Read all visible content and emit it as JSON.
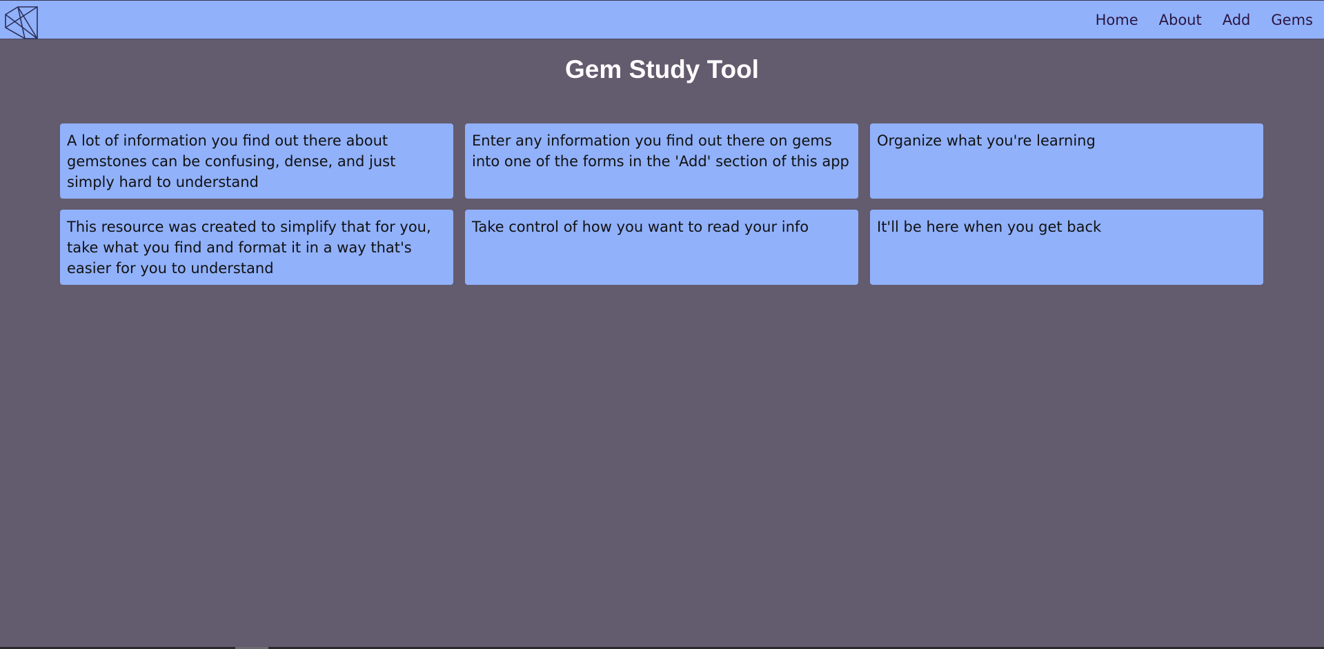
{
  "app": {
    "logo_icon": "gem-icon"
  },
  "nav": {
    "links": [
      {
        "label": "Home"
      },
      {
        "label": "About"
      },
      {
        "label": "Add"
      },
      {
        "label": "Gems"
      }
    ]
  },
  "main": {
    "title": "Gem Study Tool",
    "cards": [
      {
        "text": "A lot of information you find out there about gemstones can be confusing, dense, and just simply hard to understand"
      },
      {
        "text": "Enter any information you find out there on gems into one of the forms in the 'Add' section of this app"
      },
      {
        "text": "Organize what you're learning"
      },
      {
        "text": "This resource was created to simplify that for you, take what you find and format it in a way that's easier for you to understand"
      },
      {
        "text": "Take control of how you want to read your info"
      },
      {
        "text": "It'll be here when you get back"
      }
    ]
  },
  "colors": {
    "background": "#635b6e",
    "accent": "#91b1fb",
    "nav_text": "#2a1540",
    "card_text": "#111111",
    "title_text": "#ffffff"
  }
}
